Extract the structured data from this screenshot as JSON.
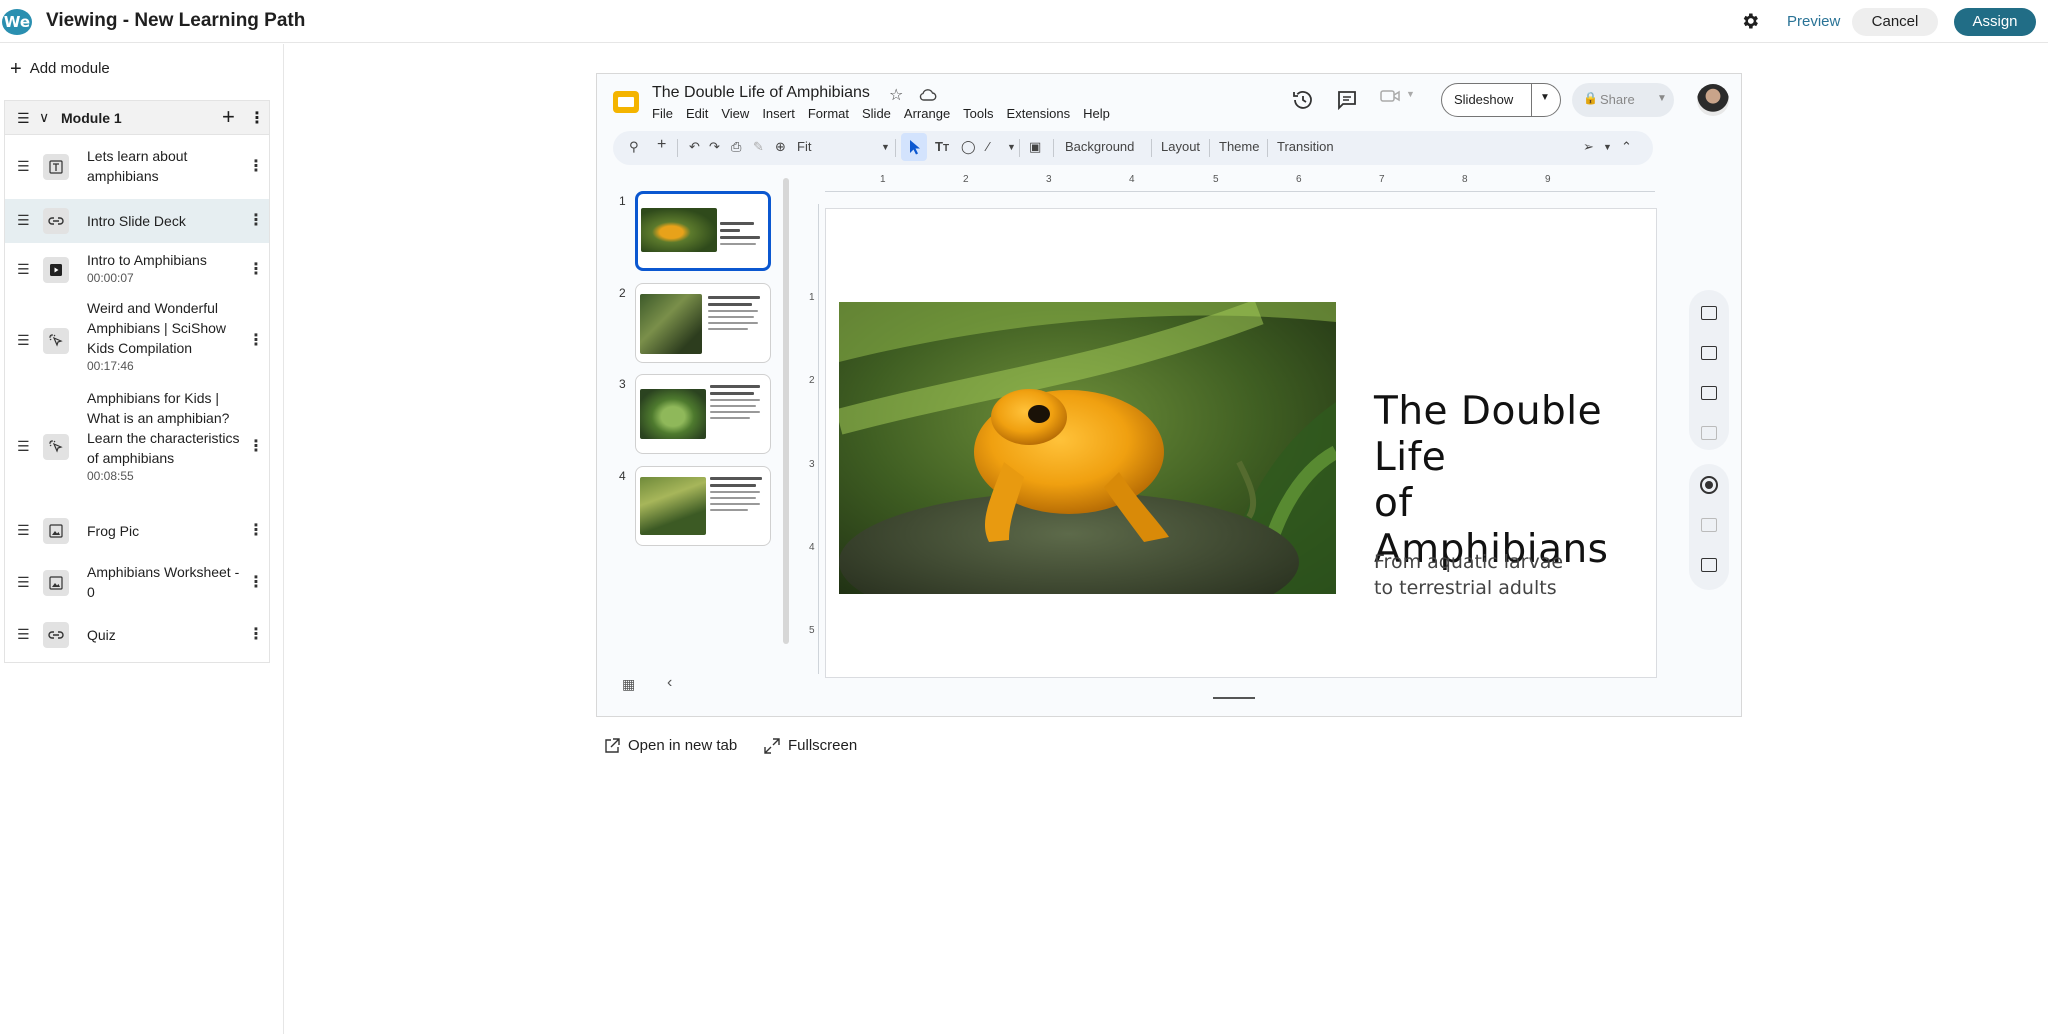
{
  "header": {
    "logo_text": "We",
    "title": "Viewing - New Learning Path",
    "settings_icon": "gear-icon",
    "preview_label": "Preview",
    "cancel_label": "Cancel",
    "assign_label": "Assign",
    "accent_color": "#216d86"
  },
  "sidebar": {
    "add_module_label": "Add module",
    "module": {
      "title": "Module 1",
      "items": [
        {
          "label": "Lets learn about amphibians",
          "icon": "text-icon",
          "duration": ""
        },
        {
          "label": "Intro Slide Deck",
          "icon": "link-icon",
          "duration": "",
          "active": true
        },
        {
          "label": "Intro to Amphibians",
          "icon": "video-icon",
          "duration": "00:00:07"
        },
        {
          "label": "Weird and Wonderful Amphibians | SciShow Kids Compilation",
          "icon": "interactive-icon",
          "duration": "00:17:46"
        },
        {
          "label": "Amphibians for Kids | What is an amphibian? Learn the characteristics of amphibians",
          "icon": "interactive-icon",
          "duration": "00:08:55"
        },
        {
          "label": "Frog Pic",
          "icon": "image-icon",
          "duration": ""
        },
        {
          "label": "Amphibians Worksheet - 0",
          "icon": "image-icon",
          "duration": ""
        },
        {
          "label": "Quiz",
          "icon": "link-icon",
          "duration": ""
        }
      ]
    }
  },
  "slides": {
    "doc_title": "The Double Life of Amphibians",
    "menu": [
      "File",
      "Edit",
      "View",
      "Insert",
      "Format",
      "Slide",
      "Arrange",
      "Tools",
      "Extensions",
      "Help"
    ],
    "slideshow_label": "Slideshow",
    "share_label": "Share",
    "toolbar": {
      "zoom_label": "Fit",
      "background_label": "Background",
      "layout_label": "Layout",
      "theme_label": "Theme",
      "transition_label": "Transition"
    },
    "thumbnails": [
      "1",
      "2",
      "3",
      "4"
    ],
    "ruler_top": [
      "1",
      "2",
      "3",
      "4",
      "5",
      "6",
      "7",
      "8",
      "9"
    ],
    "ruler_left": [
      "1",
      "2",
      "3",
      "4",
      "5"
    ],
    "current_slide": {
      "title_line1": "The Double",
      "title_line2": "Life",
      "title_line3": "of Amphibians",
      "subtitle_line1": "From aquatic larvae",
      "subtitle_line2": "to terrestrial adults"
    }
  },
  "below_frame": {
    "open_new_tab_label": "Open in new tab",
    "fullscreen_label": "Fullscreen"
  }
}
